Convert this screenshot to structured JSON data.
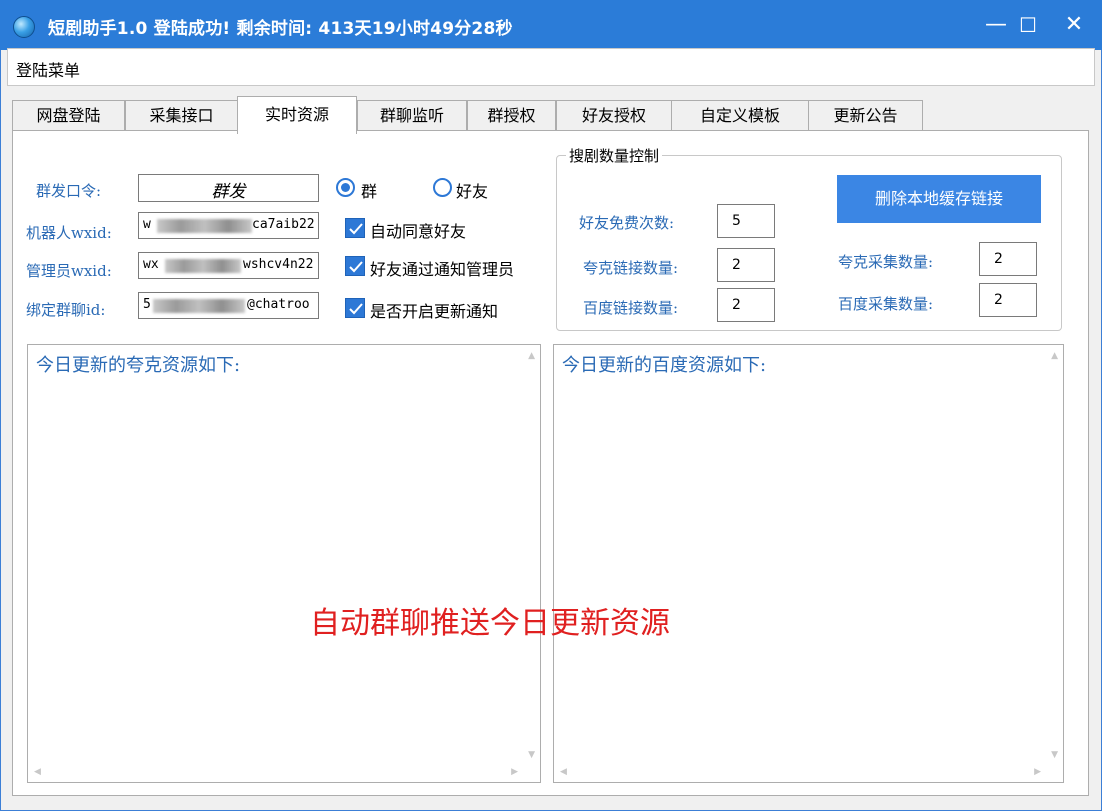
{
  "window": {
    "title": "短剧助手1.0  登陆成功! 剩余时间: 413天19小时49分28秒",
    "minimize_glyph": "—",
    "maximize_glyph": "☐",
    "close_glyph": "✕",
    "icon": "app-globe-icon"
  },
  "menu": {
    "items": [
      "登陆菜单"
    ]
  },
  "tabs": [
    "网盘登陆",
    "采集接口",
    "实时资源",
    "群聊监听",
    "群授权",
    "好友授权",
    "自定义模板",
    "更新公告"
  ],
  "active_tab": "实时资源",
  "form": {
    "command_label": "群发口令:",
    "command_value": "群发",
    "radio_group": "群",
    "radio_friend": "好友",
    "selected_radio": "群",
    "robot_label": "机器人wxid:",
    "robot_value_prefix": "w",
    "robot_value_suffix": "ca7aib22",
    "admin_label": "管理员wxid:",
    "admin_value_prefix": "wx",
    "admin_value_suffix": "wshcv4n22",
    "group_label": "绑定群聊id:",
    "group_value_prefix": "5",
    "group_value_suffix": "@chatroo",
    "checkbox_auto_agree": "自动同意好友",
    "checkbox_notify_admin": "好友通过通知管理员",
    "checkbox_update_notice": "是否开启更新通知"
  },
  "control_group": {
    "title": "搜剧数量控制",
    "free_times_label": "好友免费次数:",
    "free_times_value": "5",
    "quark_links_label": "夸克链接数量:",
    "quark_links_value": "2",
    "baidu_links_label": "百度链接数量:",
    "baidu_links_value": "2",
    "quark_collect_label": "夸克采集数量:",
    "quark_collect_value": "2",
    "baidu_collect_label": "百度采集数量:",
    "baidu_collect_value": "2",
    "delete_button": "删除本地缓存链接"
  },
  "panels": {
    "quark_text": "今日更新的夸克资源如下:",
    "baidu_text": "今日更新的百度资源如下:"
  },
  "overlay_caption": "自动群聊推送今日更新资源",
  "colors": {
    "titlebar": "#2b7cd8",
    "accent": "#2d78d6",
    "label_blue": "#2a6ab5",
    "caption_red": "#e02020"
  }
}
